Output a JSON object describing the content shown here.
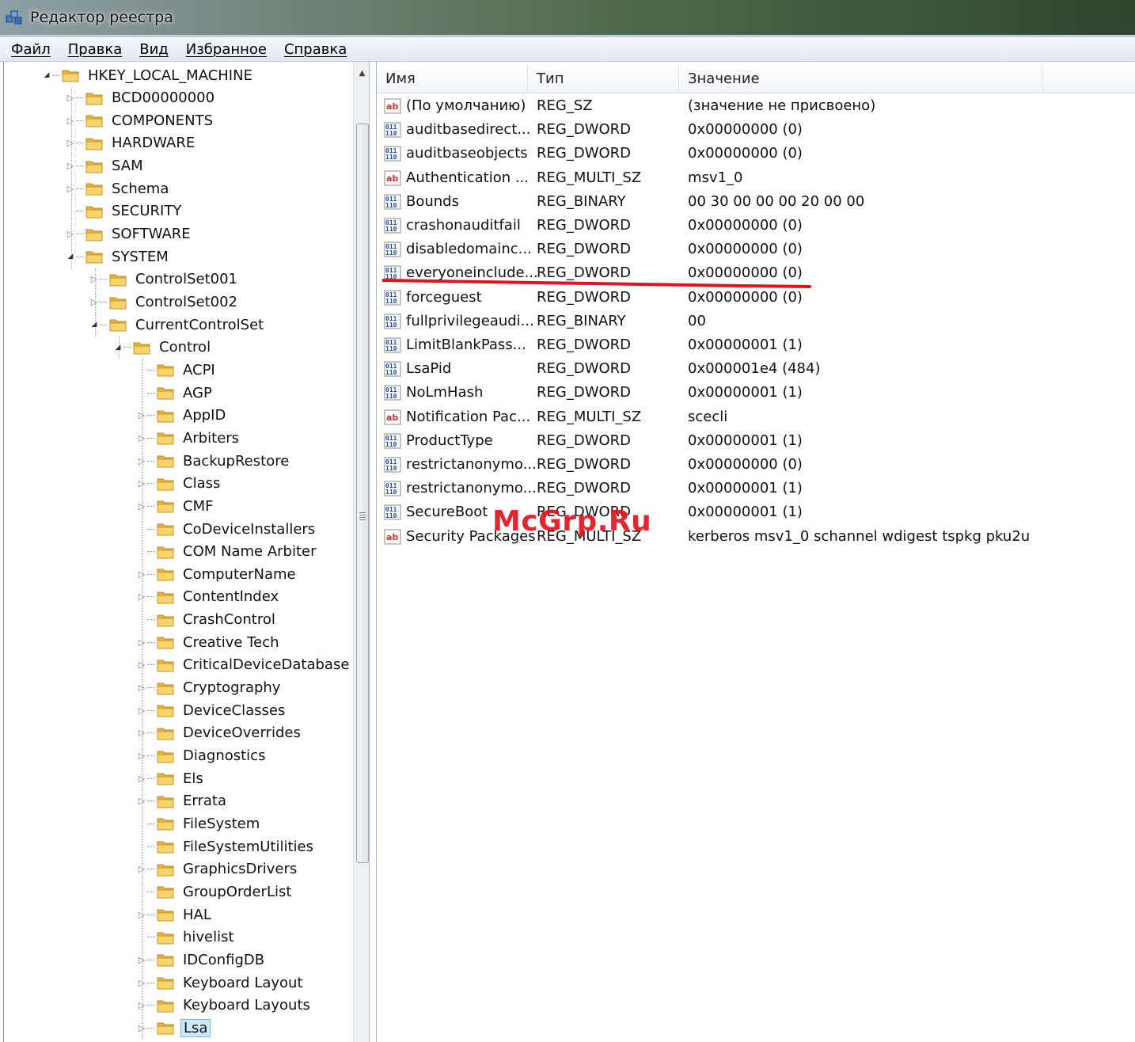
{
  "window": {
    "title": "Редактор реестра"
  },
  "menu": [
    "Файл",
    "Правка",
    "Вид",
    "Избранное",
    "Справка"
  ],
  "tree": [
    {
      "label": "HKEY_LOCAL_MACHINE",
      "level": 0,
      "expander": "open"
    },
    {
      "label": "BCD00000000",
      "level": 1,
      "expander": "closed"
    },
    {
      "label": "COMPONENTS",
      "level": 1,
      "expander": "closed"
    },
    {
      "label": "HARDWARE",
      "level": 1,
      "expander": "closed"
    },
    {
      "label": "SAM",
      "level": 1,
      "expander": "closed"
    },
    {
      "label": "Schema",
      "level": 1,
      "expander": "closed"
    },
    {
      "label": "SECURITY",
      "level": 1,
      "expander": "none"
    },
    {
      "label": "SOFTWARE",
      "level": 1,
      "expander": "closed"
    },
    {
      "label": "SYSTEM",
      "level": 1,
      "expander": "open"
    },
    {
      "label": "ControlSet001",
      "level": 2,
      "expander": "closed"
    },
    {
      "label": "ControlSet002",
      "level": 2,
      "expander": "closed"
    },
    {
      "label": "CurrentControlSet",
      "level": 2,
      "expander": "open"
    },
    {
      "label": "Control",
      "level": 3,
      "expander": "open"
    },
    {
      "label": "ACPI",
      "level": 4,
      "expander": "none"
    },
    {
      "label": "AGP",
      "level": 4,
      "expander": "none"
    },
    {
      "label": "AppID",
      "level": 4,
      "expander": "closed"
    },
    {
      "label": "Arbiters",
      "level": 4,
      "expander": "closed"
    },
    {
      "label": "BackupRestore",
      "level": 4,
      "expander": "closed"
    },
    {
      "label": "Class",
      "level": 4,
      "expander": "closed"
    },
    {
      "label": "CMF",
      "level": 4,
      "expander": "closed"
    },
    {
      "label": "CoDeviceInstallers",
      "level": 4,
      "expander": "none"
    },
    {
      "label": "COM Name Arbiter",
      "level": 4,
      "expander": "none"
    },
    {
      "label": "ComputerName",
      "level": 4,
      "expander": "closed"
    },
    {
      "label": "ContentIndex",
      "level": 4,
      "expander": "closed"
    },
    {
      "label": "CrashControl",
      "level": 4,
      "expander": "none"
    },
    {
      "label": "Creative Tech",
      "level": 4,
      "expander": "closed"
    },
    {
      "label": "CriticalDeviceDatabase",
      "level": 4,
      "expander": "closed"
    },
    {
      "label": "Cryptography",
      "level": 4,
      "expander": "closed"
    },
    {
      "label": "DeviceClasses",
      "level": 4,
      "expander": "closed"
    },
    {
      "label": "DeviceOverrides",
      "level": 4,
      "expander": "closed"
    },
    {
      "label": "Diagnostics",
      "level": 4,
      "expander": "closed"
    },
    {
      "label": "Els",
      "level": 4,
      "expander": "closed"
    },
    {
      "label": "Errata",
      "level": 4,
      "expander": "closed"
    },
    {
      "label": "FileSystem",
      "level": 4,
      "expander": "none"
    },
    {
      "label": "FileSystemUtilities",
      "level": 4,
      "expander": "none"
    },
    {
      "label": "GraphicsDrivers",
      "level": 4,
      "expander": "closed"
    },
    {
      "label": "GroupOrderList",
      "level": 4,
      "expander": "none"
    },
    {
      "label": "HAL",
      "level": 4,
      "expander": "closed"
    },
    {
      "label": "hivelist",
      "level": 4,
      "expander": "none"
    },
    {
      "label": "IDConfigDB",
      "level": 4,
      "expander": "closed"
    },
    {
      "label": "Keyboard Layout",
      "level": 4,
      "expander": "closed"
    },
    {
      "label": "Keyboard Layouts",
      "level": 4,
      "expander": "closed"
    },
    {
      "label": "Lsa",
      "level": 4,
      "expander": "closed",
      "selected": true
    }
  ],
  "list": {
    "columns": [
      "Имя",
      "Тип",
      "Значение"
    ],
    "rows": [
      {
        "icon": "string-value-icon",
        "name": "(По умолчанию)",
        "type": "REG_SZ",
        "data": "(значение не присвоено)"
      },
      {
        "icon": "binary-value-icon",
        "name": "auditbasedirect...",
        "type": "REG_DWORD",
        "data": "0x00000000 (0)"
      },
      {
        "icon": "binary-value-icon",
        "name": "auditbaseobjects",
        "type": "REG_DWORD",
        "data": "0x00000000 (0)"
      },
      {
        "icon": "string-value-icon",
        "name": "Authentication ...",
        "type": "REG_MULTI_SZ",
        "data": "msv1_0"
      },
      {
        "icon": "binary-value-icon",
        "name": "Bounds",
        "type": "REG_BINARY",
        "data": "00 30 00 00 00 20 00 00"
      },
      {
        "icon": "binary-value-icon",
        "name": "crashonauditfail",
        "type": "REG_DWORD",
        "data": "0x00000000 (0)"
      },
      {
        "icon": "binary-value-icon",
        "name": "disabledomainc...",
        "type": "REG_DWORD",
        "data": "0x00000000 (0)"
      },
      {
        "icon": "binary-value-icon",
        "name": "everyoneinclude...",
        "type": "REG_DWORD",
        "data": "0x00000000 (0)"
      },
      {
        "icon": "binary-value-icon",
        "name": "forceguest",
        "type": "REG_DWORD",
        "data": "0x00000000 (0)"
      },
      {
        "icon": "binary-value-icon",
        "name": "fullprivilegeaudi...",
        "type": "REG_BINARY",
        "data": "00"
      },
      {
        "icon": "binary-value-icon",
        "name": "LimitBlankPass...",
        "type": "REG_DWORD",
        "data": "0x00000001 (1)"
      },
      {
        "icon": "binary-value-icon",
        "name": "LsaPid",
        "type": "REG_DWORD",
        "data": "0x000001e4 (484)"
      },
      {
        "icon": "binary-value-icon",
        "name": "NoLmHash",
        "type": "REG_DWORD",
        "data": "0x00000001 (1)"
      },
      {
        "icon": "string-value-icon",
        "name": "Notification Pac...",
        "type": "REG_MULTI_SZ",
        "data": "scecli"
      },
      {
        "icon": "binary-value-icon",
        "name": "ProductType",
        "type": "REG_DWORD",
        "data": "0x00000001 (1)"
      },
      {
        "icon": "binary-value-icon",
        "name": "restrictanonymo...",
        "type": "REG_DWORD",
        "data": "0x00000000 (0)"
      },
      {
        "icon": "binary-value-icon",
        "name": "restrictanonymo...",
        "type": "REG_DWORD",
        "data": "0x00000001 (1)"
      },
      {
        "icon": "binary-value-icon",
        "name": "SecureBoot",
        "type": "REG_DWORD",
        "data": "0x00000001 (1)"
      },
      {
        "icon": "string-value-icon",
        "name": "Security Packages",
        "type": "REG_MULTI_SZ",
        "data": "kerberos msv1_0 schannel wdigest tspkg pku2u"
      }
    ]
  },
  "watermark": "McGrp.Ru",
  "colors": {
    "highlight": "#e1141e",
    "selection": "#cde8ff",
    "folder": "#f0c44a"
  }
}
